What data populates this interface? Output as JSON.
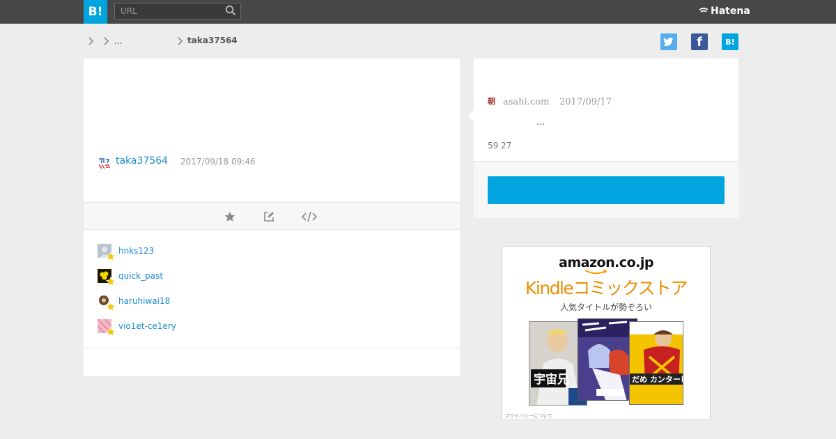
{
  "header": {
    "logo_label": "B!",
    "search_placeholder": "URL",
    "brand": "Hatena"
  },
  "breadcrumb": {
    "ellipsis": "...",
    "user": "taka37564"
  },
  "social": {
    "twitter_label": "",
    "facebook_label": "f",
    "hatena_label": "B!"
  },
  "bookmark": {
    "user": "taka37564",
    "date": "2017/09/18 09:46",
    "actions": [
      "star",
      "edit",
      "embed"
    ]
  },
  "stars": [
    {
      "user": "hnks123",
      "avatar_color": "#b8c4cc"
    },
    {
      "user": "quick_past",
      "avatar_color": "#f2d600"
    },
    {
      "user": "haruhiwai18",
      "avatar_color": "#6a4a2a"
    },
    {
      "user": "vio1et-ce1ery",
      "avatar_color": "#f0b8c8"
    }
  ],
  "entry": {
    "favicon": "朝",
    "site": "asahi.com",
    "date": "2017/09/17",
    "title": "...",
    "count": "59 27",
    "cta_label": ""
  },
  "ad": {
    "brand": "amazon.co.jp",
    "headline": "Kindleコミックストア",
    "subline": "人気タイトルが勢ぞろい",
    "privacy": "プライバシーについて"
  },
  "colors": {
    "accent": "#00a4de",
    "link": "#1b8bd0",
    "topbar": "#474747",
    "star": "#f6c700"
  }
}
